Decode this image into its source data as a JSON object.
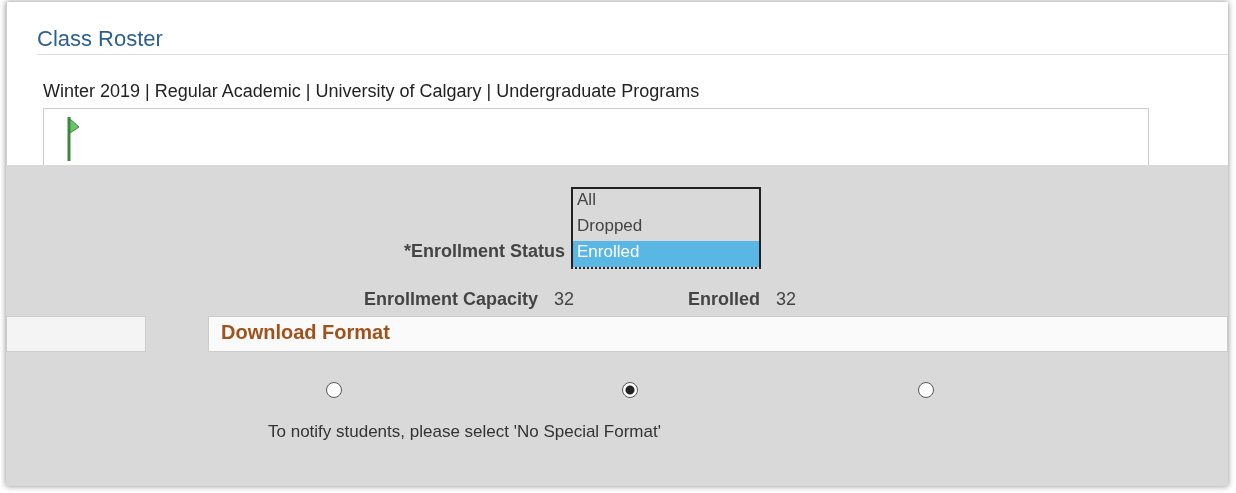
{
  "page": {
    "title": "Class Roster",
    "term": "Winter 2019 | Regular Academic | University of Calgary | Undergraduate Programs"
  },
  "enrollment_status": {
    "label": "*Enrollment Status",
    "options": [
      {
        "label": "All",
        "selected": false
      },
      {
        "label": "Dropped",
        "selected": false
      },
      {
        "label": "Enrolled",
        "selected": true
      }
    ]
  },
  "counts": [
    {
      "label": "Enrollment Capacity",
      "value": "32"
    },
    {
      "label": "Enrolled",
      "value": "32"
    }
  ],
  "download_format": {
    "title": "Download Format",
    "options": [
      {
        "selected": false
      },
      {
        "selected": true
      },
      {
        "selected": false
      }
    ],
    "note": "To notify students, please select 'No Special Format'"
  }
}
